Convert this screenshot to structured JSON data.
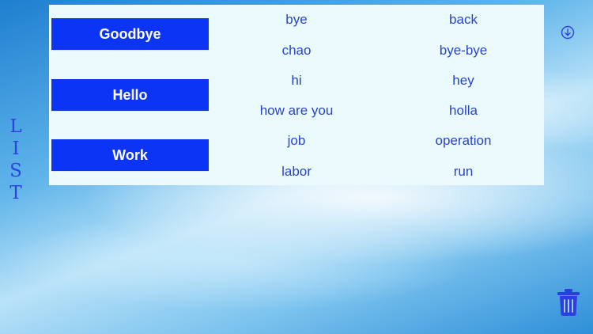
{
  "side_title_letters": [
    "L",
    "I",
    "S",
    "T"
  ],
  "groups": [
    {
      "label": "Goodbye",
      "words": [
        "bye",
        "back",
        "chao",
        "bye-bye"
      ]
    },
    {
      "label": "Hello",
      "words": [
        "hi",
        "hey",
        "how are you",
        "holla"
      ]
    },
    {
      "label": "Work",
      "words": [
        "job",
        "operation",
        "labor",
        "run"
      ]
    }
  ],
  "icons": {
    "download": "arrow-down-circle-icon",
    "delete": "trash-icon"
  },
  "colors": {
    "accent_blue": "#0b34f5",
    "text_blue": "#2a44c9",
    "panel_bg": "#eafafd"
  }
}
